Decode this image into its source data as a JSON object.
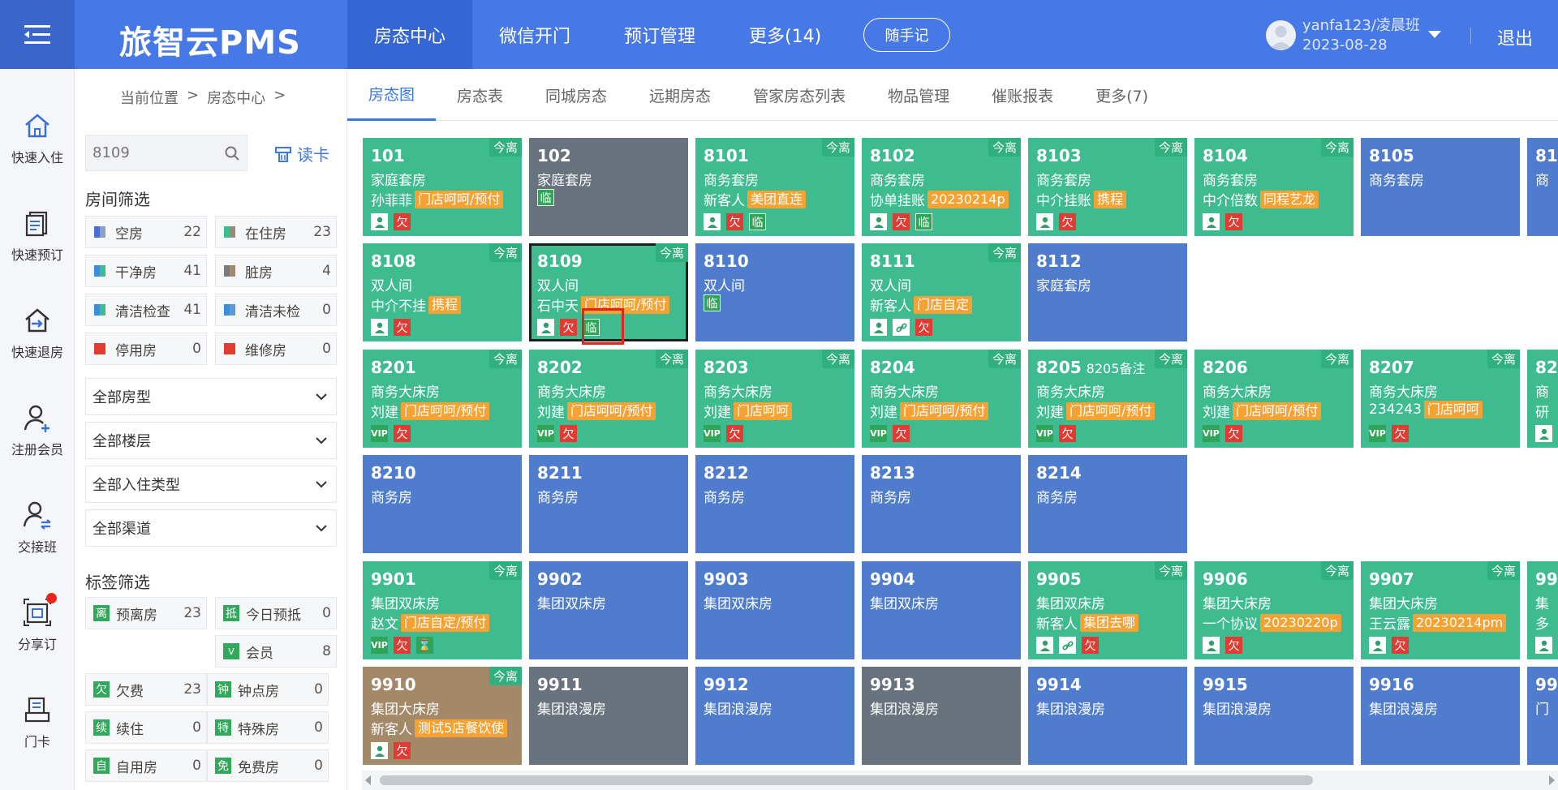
{
  "app": {
    "brand": "旅智云PMS"
  },
  "nav": [
    "房态中心",
    "微信开门",
    "预订管理",
    "更多(14)"
  ],
  "memo_button": "随手记",
  "user": {
    "name": "yanfa123/凌晨班",
    "date": "2023-08-28"
  },
  "logout": "退出",
  "rail": [
    {
      "label": "快速入住",
      "icon": "home-icon"
    },
    {
      "label": "快速预订",
      "icon": "book-icon"
    },
    {
      "label": "快速退房",
      "icon": "checkout-icon"
    },
    {
      "label": "注册会员",
      "icon": "member-add-icon"
    },
    {
      "label": "交接班",
      "icon": "shift-icon"
    },
    {
      "label": "分享订",
      "icon": "share-order-icon"
    },
    {
      "label": "门卡",
      "icon": "door-card-icon"
    }
  ],
  "breadcrumb": [
    "当前位置",
    ">",
    "房态中心",
    ">"
  ],
  "search": {
    "placeholder": "8109"
  },
  "read_card": "读卡",
  "room_filter_title": "房间筛选",
  "room_filters": [
    {
      "label": "空房",
      "count": "22",
      "color": "#4a6fd0"
    },
    {
      "label": "在住房",
      "count": "23",
      "color": "#3fbc8f"
    },
    {
      "label": "干净房",
      "count": "41",
      "color": "#3a8fd8"
    },
    {
      "label": "脏房",
      "count": "4",
      "color": "#7b7b7b"
    },
    {
      "label": "清洁检查",
      "count": "41",
      "color": "#3fbc8f"
    },
    {
      "label": "清洁未检",
      "count": "0",
      "color": "#3a8fd8"
    },
    {
      "label": "停用房",
      "count": "0",
      "color": "#e13b34"
    },
    {
      "label": "维修房",
      "count": "0",
      "color": "#e13b34"
    }
  ],
  "selects": [
    "全部房型",
    "全部楼层",
    "全部入住类型",
    "全部渠道"
  ],
  "tag_filter_title": "标签筛选",
  "tag_filters": [
    {
      "badge": "离",
      "label": "预离房",
      "count": "23"
    },
    {
      "badge": "抵",
      "label": "今日预抵",
      "count": "0"
    },
    {
      "badge": "V",
      "label": "会员",
      "count": "8"
    },
    {
      "badge": "欠",
      "label": "欠费",
      "count": "23"
    },
    {
      "badge": "钟",
      "label": "钟点房",
      "count": "0"
    },
    {
      "badge": "续",
      "label": "续住",
      "count": "0"
    },
    {
      "badge": "特",
      "label": "特殊房",
      "count": "0"
    },
    {
      "badge": "自",
      "label": "自用房",
      "count": "0"
    },
    {
      "badge": "免",
      "label": "免费房",
      "count": "0"
    }
  ],
  "tabs": [
    "房态图",
    "房态表",
    "同城房态",
    "远期房态",
    "管家房态列表",
    "物品管理",
    "催账报表",
    "更多(7)"
  ],
  "leave_tag": "今离",
  "rooms": [
    {
      "no": "101",
      "type": "家庭套房",
      "color": "green",
      "guest": "孙菲菲",
      "source": "门店呵呵/预付",
      "leave": true,
      "icons": [
        "user",
        "owe"
      ]
    },
    {
      "no": "102",
      "type": "家庭套房",
      "color": "gray",
      "guest": "",
      "source": "",
      "leave": false,
      "icons": [
        "lin"
      ]
    },
    {
      "no": "8101",
      "type": "商务套房",
      "color": "green",
      "guest": "新客人",
      "source": "美团直连",
      "leave": true,
      "icons": [
        "user",
        "owe",
        "lin"
      ]
    },
    {
      "no": "8102",
      "type": "商务套房",
      "color": "green",
      "guest": "协单挂账",
      "source": "20230214p",
      "leave": true,
      "icons": [
        "user",
        "owe",
        "lin"
      ]
    },
    {
      "no": "8103",
      "type": "商务套房",
      "color": "green",
      "guest": "中介挂账",
      "source": "携程",
      "leave": true,
      "icons": [
        "user",
        "owe"
      ]
    },
    {
      "no": "8104",
      "type": "商务套房",
      "color": "green",
      "guest": "中介倍数",
      "source": "同程艺龙",
      "leave": true,
      "icons": [
        "user",
        "owe"
      ]
    },
    {
      "no": "8105",
      "type": "商务套房",
      "color": "blue",
      "guest": "",
      "source": "",
      "leave": false,
      "icons": []
    },
    {
      "no": "81",
      "type": "商",
      "color": "blue",
      "guest": "",
      "source": "",
      "leave": false,
      "icons": []
    },
    {
      "no": "8108",
      "type": "双人间",
      "color": "green",
      "guest": "中介不挂",
      "source": "携程",
      "leave": true,
      "icons": [
        "user",
        "owe"
      ]
    },
    {
      "no": "8109",
      "type": "双人间",
      "color": "green",
      "guest": "石中天",
      "source": "门店呵呵/预付",
      "leave": true,
      "icons": [
        "user",
        "owe",
        "lin"
      ],
      "selected": true
    },
    {
      "no": "8110",
      "type": "双人间",
      "color": "blue",
      "guest": "",
      "source": "",
      "leave": false,
      "icons": [
        "lin"
      ]
    },
    {
      "no": "8111",
      "type": "双人间",
      "color": "green",
      "guest": "新客人",
      "source": "门店自定",
      "leave": true,
      "icons": [
        "user",
        "link",
        "owe"
      ]
    },
    {
      "no": "8112",
      "type": "家庭套房",
      "color": "blue",
      "guest": "",
      "source": "",
      "leave": false,
      "icons": []
    },
    {
      "no": "8201",
      "type": "商务大床房",
      "color": "green",
      "guest": "刘建",
      "source": "门店呵呵/预付",
      "leave": true,
      "icons": [
        "vip",
        "owe"
      ]
    },
    {
      "no": "8202",
      "type": "商务大床房",
      "color": "green",
      "guest": "刘建",
      "source": "门店呵呵/预付",
      "leave": true,
      "icons": [
        "vip",
        "owe"
      ]
    },
    {
      "no": "8203",
      "type": "商务大床房",
      "color": "green",
      "guest": "刘建",
      "source": "门店呵呵",
      "leave": true,
      "icons": [
        "vip",
        "owe"
      ]
    },
    {
      "no": "8204",
      "type": "商务大床房",
      "color": "green",
      "guest": "刘建",
      "source": "门店呵呵/预付",
      "leave": true,
      "icons": [
        "vip",
        "owe"
      ]
    },
    {
      "no": "8205",
      "note": "8205备注",
      "type": "商务大床房",
      "color": "green",
      "guest": "刘建",
      "source": "门店呵呵/预付",
      "leave": true,
      "icons": [
        "vip",
        "owe"
      ]
    },
    {
      "no": "8206",
      "type": "商务大床房",
      "color": "green",
      "guest": "刘建",
      "source": "门店呵呵/预付",
      "leave": true,
      "icons": [
        "vip",
        "owe"
      ]
    },
    {
      "no": "8207",
      "type": "商务大床房",
      "color": "green",
      "guest": "234243",
      "source": "门店呵呵",
      "leave": true,
      "icons": [
        "vip",
        "owe"
      ]
    },
    {
      "no": "82",
      "type": "商",
      "color": "green",
      "guest": "研",
      "source": "",
      "leave": false,
      "icons": [
        "user"
      ]
    },
    {
      "no": "8210",
      "type": "商务房",
      "color": "blue",
      "guest": "",
      "source": "",
      "leave": false,
      "icons": []
    },
    {
      "no": "8211",
      "type": "商务房",
      "color": "blue",
      "guest": "",
      "source": "",
      "leave": false,
      "icons": []
    },
    {
      "no": "8212",
      "type": "商务房",
      "color": "blue",
      "guest": "",
      "source": "",
      "leave": false,
      "icons": []
    },
    {
      "no": "8213",
      "type": "商务房",
      "color": "blue",
      "guest": "",
      "source": "",
      "leave": false,
      "icons": []
    },
    {
      "no": "8214",
      "type": "商务房",
      "color": "blue",
      "guest": "",
      "source": "",
      "leave": false,
      "icons": []
    },
    {
      "no": "9901",
      "type": "集团双床房",
      "color": "green",
      "guest": "赵文",
      "source": "门店自定/预付",
      "leave": true,
      "icons": [
        "vip",
        "owe",
        "hour"
      ]
    },
    {
      "no": "9902",
      "type": "集团双床房",
      "color": "blue",
      "guest": "",
      "source": "",
      "leave": false,
      "icons": []
    },
    {
      "no": "9903",
      "type": "集团双床房",
      "color": "blue",
      "guest": "",
      "source": "",
      "leave": false,
      "icons": []
    },
    {
      "no": "9904",
      "type": "集团双床房",
      "color": "blue",
      "guest": "",
      "source": "",
      "leave": false,
      "icons": []
    },
    {
      "no": "9905",
      "type": "集团双床房",
      "color": "green",
      "guest": "新客人",
      "source": "集团去哪",
      "leave": true,
      "icons": [
        "user",
        "link",
        "owe"
      ]
    },
    {
      "no": "9906",
      "type": "集团大床房",
      "color": "green",
      "guest": "一个协议",
      "source": "20230220p",
      "leave": true,
      "icons": [
        "user",
        "owe"
      ]
    },
    {
      "no": "9907",
      "type": "集团大床房",
      "color": "green",
      "guest": "王云露",
      "source": "20230214pm",
      "leave": true,
      "icons": [
        "user",
        "owe"
      ]
    },
    {
      "no": "99",
      "type": "集",
      "color": "green",
      "guest": "多",
      "source": "",
      "leave": false,
      "icons": [
        "user"
      ]
    },
    {
      "no": "9910",
      "type": "集团大床房",
      "color": "brown",
      "guest": "新客人",
      "source": "测试5店餐饮使",
      "leave": true,
      "icons": [
        "user",
        "owe"
      ]
    },
    {
      "no": "9911",
      "type": "集团浪漫房",
      "color": "gray",
      "guest": "",
      "source": "",
      "leave": false,
      "icons": []
    },
    {
      "no": "9912",
      "type": "集团浪漫房",
      "color": "blue",
      "guest": "",
      "source": "",
      "leave": false,
      "icons": []
    },
    {
      "no": "9913",
      "type": "集团浪漫房",
      "color": "gray",
      "guest": "",
      "source": "",
      "leave": false,
      "icons": []
    },
    {
      "no": "9914",
      "type": "集团浪漫房",
      "color": "blue",
      "guest": "",
      "source": "",
      "leave": false,
      "icons": []
    },
    {
      "no": "9915",
      "type": "集团浪漫房",
      "color": "blue",
      "guest": "",
      "source": "",
      "leave": false,
      "icons": []
    },
    {
      "no": "9916",
      "type": "集团浪漫房",
      "color": "blue",
      "guest": "",
      "source": "",
      "leave": false,
      "icons": []
    },
    {
      "no": "99",
      "type": "门",
      "color": "blue",
      "guest": "",
      "source": "",
      "leave": false,
      "icons": []
    }
  ],
  "badge_text": {
    "owe": "欠",
    "lin": "临",
    "vip": "VIP",
    "hour": "⌛",
    "link": "🔗",
    "user": "👤"
  }
}
